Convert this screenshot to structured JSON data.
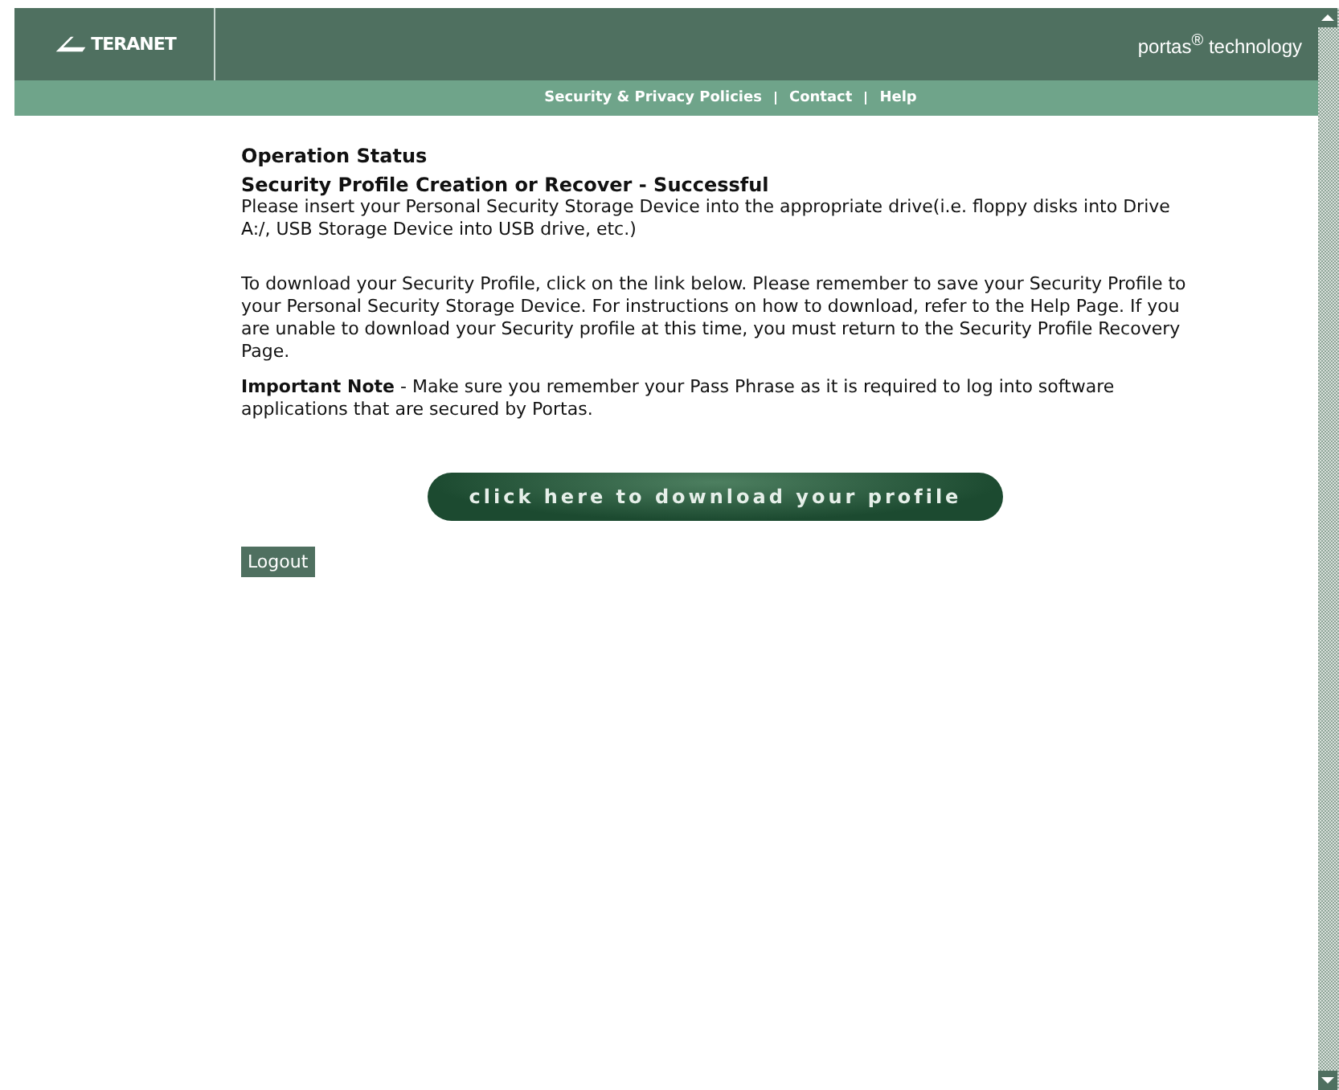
{
  "header": {
    "logo": "TERANET",
    "tagline": "portas$^{®}$ technology"
  },
  "nav": [
    "Security & Privacy Policies",
    "Contact",
    "Help"
  ],
  "status": {
    "heading": "Operation Status",
    "subheading": "Security Profile Creation or Recover - Successful",
    "instruction": "Please insert your Personal Security Storage Device into the appropriate drive(i.e. floppy disks into Drive A:/, USB Storage Device into USB drive, etc.)"
  },
  "paragraphs": [
    "To download your Security Profile, click on the link below. Please remember to save your Security Profile to your Personal Security Storage Device. For instructions on how to download, refer to the Help Page. If you are unable to download your Security profile at this time, you must return to the Security Profile Recovery Page.",
    "**Important Note** - Make sure you remember your Pass Phrase as it is required to log into software applications that are secured by Portas."
  ],
  "download_button": "click here to download your profile",
  "logout_button": "Logout"
}
